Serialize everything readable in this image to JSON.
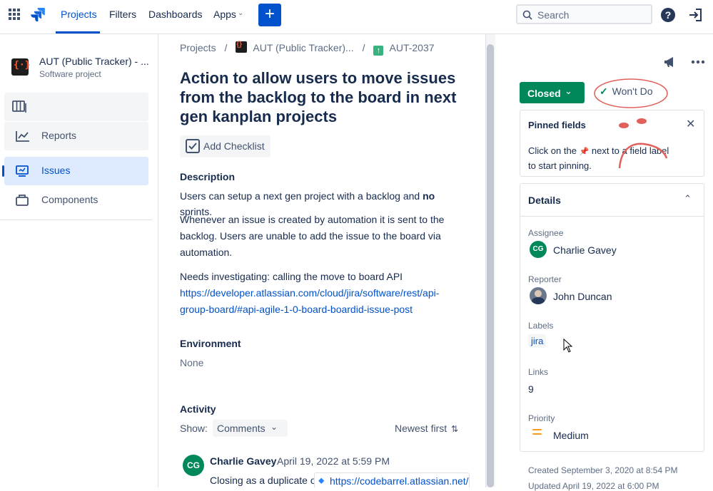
{
  "topbar": {
    "projects": "Projects",
    "filters": "Filters",
    "dashboards": "Dashboards",
    "apps": "Apps",
    "search_placeholder": "Search"
  },
  "sidebar": {
    "project_name": "AUT (Public Tracker) - ...",
    "project_type": "Software project",
    "items": [
      {
        "label": ""
      },
      {
        "label": "Reports"
      },
      {
        "label": "Issues"
      },
      {
        "label": "Components"
      }
    ]
  },
  "breadcrumb": {
    "projects": "Projects",
    "project": "AUT (Public Tracker)...",
    "issue_key": "AUT-2037",
    "sep": "/"
  },
  "issue": {
    "title": "Action to allow users to move issues from the backlog to the board in next gen kanplan projects",
    "add_checklist": "Add Checklist",
    "description_heading": "Description",
    "desc_p1_a": "Users can setup a next gen project with a backlog and ",
    "desc_p1_bold": "no",
    "desc_p1_b": " sprints.",
    "desc_p2": "Whenever an issue is created by automation it is sent to the backlog. Users are unable to add the issue to the board via automation.",
    "desc_p3": "Needs investigating: calling the move to board API",
    "desc_link": "https://developer.atlassian.com/cloud/jira/software/rest/api-group-board/#api-agile-1-0-board-boardid-issue-post",
    "environment_heading": "Environment",
    "environment_value": "None",
    "activity_heading": "Activity",
    "show_label": "Show:",
    "comments_select": "Comments",
    "sort_label": "Newest first",
    "comment": {
      "author": "Charlie Gavey",
      "initials": "CG",
      "date": "April 19, 2022 at 5:59 PM",
      "text": "Closing as a duplicate of",
      "link": "https://codebarrel.atlassian.net/b"
    }
  },
  "right": {
    "status": "Closed",
    "resolution": "Won't Do",
    "pinned_title": "Pinned fields",
    "pinned_text_a": "Click on the",
    "pinned_text_b": "next to a field label",
    "pinned_text_c": "to start pinning.",
    "details_title": "Details",
    "assignee_label": "Assignee",
    "assignee_name": "Charlie Gavey",
    "assignee_initials": "CG",
    "reporter_label": "Reporter",
    "reporter_name": "John Duncan",
    "labels_label": "Labels",
    "label_value": "jira",
    "links_label": "Links",
    "links_value": "9",
    "priority_label": "Priority",
    "priority_value": "Medium",
    "created": "Created September 3, 2020 at 8:54 PM",
    "updated": "Updated April 19, 2022 at 6:00 PM"
  },
  "colors": {
    "accent": "#0052cc",
    "status_green": "#00875a",
    "priority_orange": "#ff991f",
    "annotation_red": "#e2605a"
  }
}
